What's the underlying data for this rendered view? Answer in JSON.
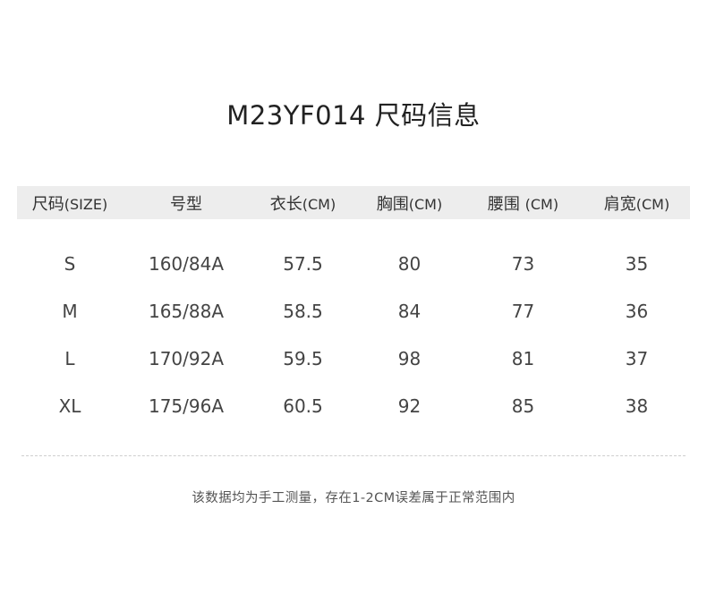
{
  "title": "M23YF014 尺码信息",
  "table": {
    "headers": [
      {
        "label": "尺码",
        "unit": "(SIZE)"
      },
      {
        "label": "号型",
        "unit": ""
      },
      {
        "label": "衣长",
        "unit": "(CM)"
      },
      {
        "label": "胸围",
        "unit": "(CM)"
      },
      {
        "label": "腰围 ",
        "unit": "(CM)"
      },
      {
        "label": "肩宽",
        "unit": "(CM)"
      }
    ],
    "rows": [
      [
        "S",
        "160/84A",
        "57.5",
        "80",
        "73",
        "35"
      ],
      [
        "M",
        "165/88A",
        "58.5",
        "84",
        "77",
        "36"
      ],
      [
        "L",
        "170/92A",
        "59.5",
        "98",
        "81",
        "37"
      ],
      [
        "XL",
        "175/96A",
        "60.5",
        "92",
        "85",
        "38"
      ]
    ]
  },
  "note": "该数据均为手工测量，存在1-2CM误差属于正常范围内",
  "colors": {
    "header_background": "#ededed",
    "divider": "#cfcfcf",
    "text": "#333333"
  }
}
